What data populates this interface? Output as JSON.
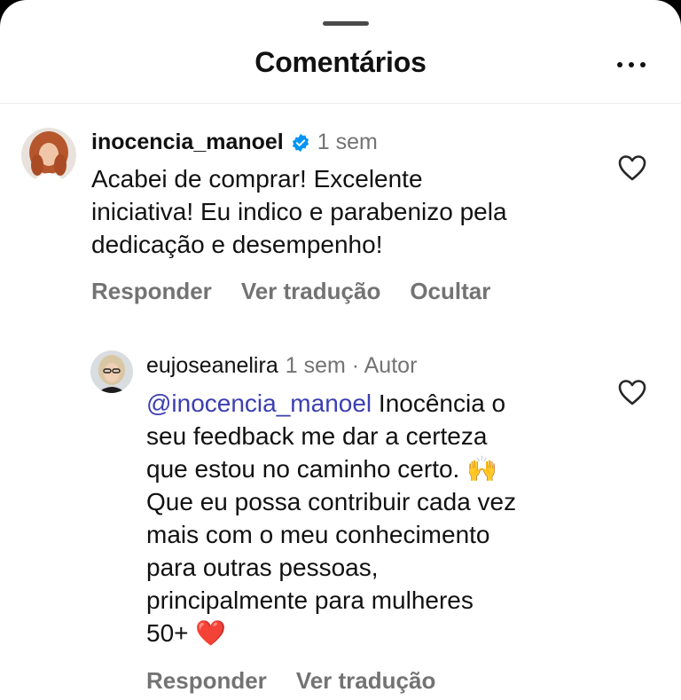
{
  "sheet": {
    "title": "Comentários",
    "more_icon": "more-horizontal-icon"
  },
  "comments": [
    {
      "username": "inocencia_manoel",
      "verified": true,
      "time": "1 sem",
      "text_lines": [
        "Acabei de comprar! Excelente",
        "iniciativa! Eu indico e parabenizo pela",
        "dedicação e desempenho!"
      ],
      "actions": [
        "Responder",
        "Ver tradução",
        "Ocultar"
      ],
      "like_icon": "heart-outline-icon"
    },
    {
      "username": "eujoseanelira",
      "time": "1 sem · Autor",
      "mention": "@inocencia_manoel",
      "text_first": " Inocência o",
      "text_lines": [
        "seu feedback me dar a certeza",
        "que estou no caminho certo. 🙌",
        "Que eu possa contribuir cada vez",
        "mais com o meu conhecimento",
        "para outras pessoas,",
        "principalmente para mulheres",
        "50+ ❤️"
      ],
      "actions": [
        "Responder",
        "Ver tradução"
      ],
      "like_icon": "heart-outline-icon"
    }
  ],
  "colors": {
    "background": "#ffffff",
    "text": "#111111",
    "muted": "#737373",
    "mention": "#3b3fb0",
    "verified": "#0095f6"
  }
}
